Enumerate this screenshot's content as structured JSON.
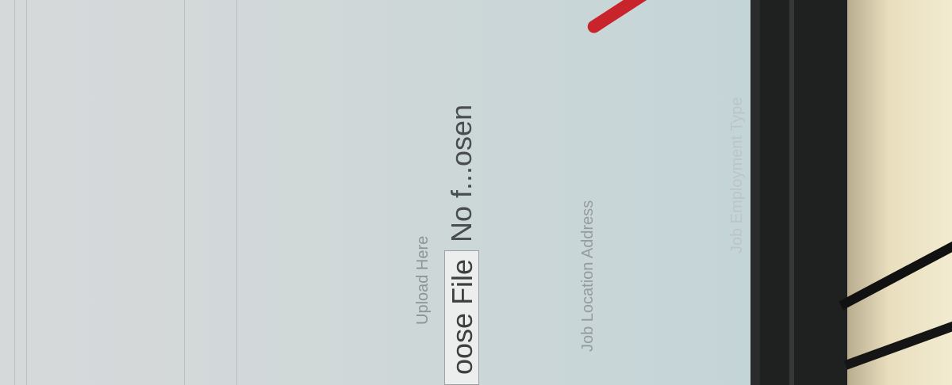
{
  "form": {
    "upload_label": "Upload Here",
    "choose_file_label": "oose File",
    "file_status": "No f...osen",
    "job_location_label": "Job Location Address",
    "job_employment_label": "Job Employment Type"
  },
  "colors": {
    "screen_bg": "#cfd8d9",
    "pen": "#c9232c",
    "bezel": "#1f2020"
  }
}
